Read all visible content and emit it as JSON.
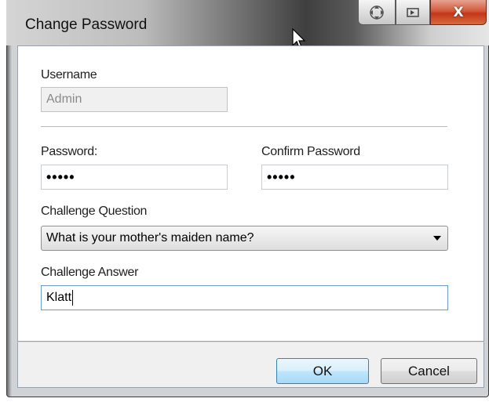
{
  "window": {
    "title": "Change Password"
  },
  "titlebar_buttons": [
    {
      "name": "move-icon"
    },
    {
      "name": "restore-icon"
    },
    {
      "name": "close-icon",
      "label": "X"
    }
  ],
  "form": {
    "username": {
      "label": "Username",
      "value": "Admin"
    },
    "password": {
      "label": "Password:",
      "value": "•••••"
    },
    "confirm_password": {
      "label": "Confirm Password",
      "value": "•••••"
    },
    "challenge_question": {
      "label": "Challenge Question",
      "selected": "What is your mother's maiden name?"
    },
    "challenge_answer": {
      "label": "Challenge Answer",
      "value": "Klatt"
    }
  },
  "buttons": {
    "ok": "OK",
    "cancel": "Cancel"
  },
  "colors": {
    "close_button": "#c1371a",
    "default_button_border": "#3c7fb1"
  }
}
